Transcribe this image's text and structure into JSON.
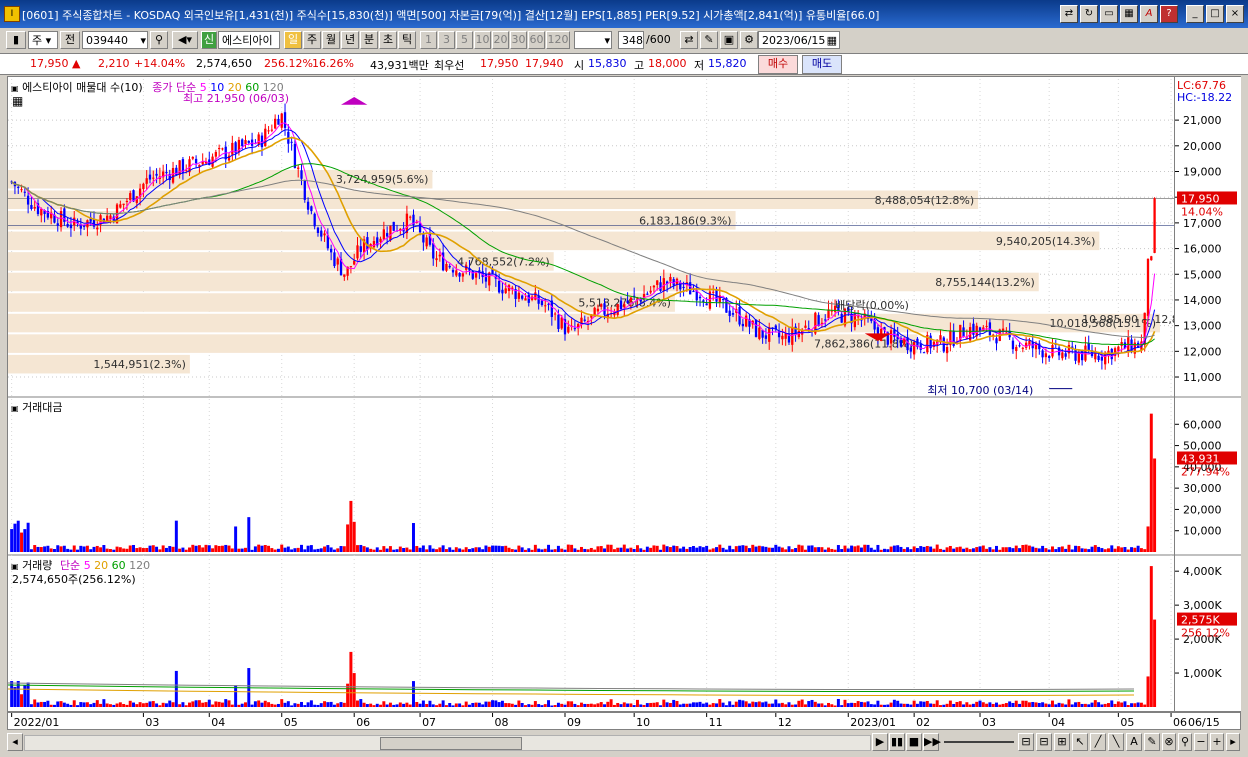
{
  "window": {
    "title": "[0601] 주식종합차트 - KOSDAQ 외국인보유[1,431(천)] 주식수[15,830(천)] 액면[500] 자본금[79(억)] 결산[12월] EPS[1,885] PER[9.52] 시가총액[2,841(억)] 유통비율[66.0]"
  },
  "toolbar": {
    "market": "주",
    "scope": "전",
    "code": "039440",
    "name": "에스티아이",
    "periods": [
      "일",
      "주",
      "월",
      "년",
      "분",
      "초",
      "틱"
    ],
    "active_period": "일",
    "intervals": [
      "1",
      "3",
      "5",
      "10",
      "20",
      "30",
      "60",
      "120"
    ],
    "count": "348",
    "count_total": "/600",
    "date": "2023/06/15"
  },
  "quote": {
    "price": "17,950",
    "arrow": "▲",
    "change": "2,210",
    "change_pct": "+14.04%",
    "volume": "2,574,650",
    "volume_ratio": "256.12%",
    "turnover": "16.26%",
    "amount": "43,931백만",
    "best_label": "최우선",
    "ask": "17,950",
    "bid": "17,940",
    "open_label": "시",
    "open": "15,830",
    "high_label": "고",
    "high": "18,000",
    "low_label": "저",
    "low": "15,820",
    "buy_label": "매수",
    "sell_label": "매도"
  },
  "price_pane": {
    "title": "에스티아이 매물대 수(10)",
    "ma_prefix": "종가 단순",
    "ma_labels": [
      "5",
      "10",
      "20",
      "60",
      "120"
    ],
    "ma_colors": [
      "#ff00ff",
      "#0000ff",
      "#e0a000",
      "#00a000",
      "#808080"
    ],
    "high_note": "최고 21,950 (06/03)",
    "low_note": "최저 10,700 (03/14)",
    "dividend_note": "배당락(0.00%)",
    "range_note": "10,985.00 ~ 12,890.00",
    "lc": "LC:67.76",
    "hc": "HC:-18.22",
    "y_ticks": [
      "21,000",
      "20,000",
      "19,000",
      "18,000",
      "17,000",
      "16,000",
      "15,000",
      "14,000",
      "13,000",
      "12,000",
      "11,000"
    ],
    "current_price_tag": "17,950",
    "current_pct_tag": "14.04%",
    "volume_profile": [
      {
        "label": "1,544,951(2.3%)",
        "price_low": 11100,
        "price_high": 11900,
        "fraction": 0.03
      },
      {
        "label": "7,862,386(11.8%)",
        "price_low": 11900,
        "price_high": 12700,
        "fraction": 0.15
      },
      {
        "label": "10,018,568(15.1%)",
        "price_low": 12700,
        "price_high": 13500,
        "fraction": 0.19
      },
      {
        "label": "5,518,276(8.4%)",
        "price_low": 13500,
        "price_high": 14300,
        "fraction": 0.11
      },
      {
        "label": "8,755,144(13.2%)",
        "price_low": 14300,
        "price_high": 15100,
        "fraction": 0.17
      },
      {
        "label": "4,768,552(7.2%)",
        "price_low": 15100,
        "price_high": 15900,
        "fraction": 0.09
      },
      {
        "label": "9,540,205(14.3%)",
        "price_low": 15900,
        "price_high": 16700,
        "fraction": 0.18
      },
      {
        "label": "6,183,186(9.3%)",
        "price_low": 16700,
        "price_high": 17500,
        "fraction": 0.12
      },
      {
        "label": "8,488,054(12.8%)",
        "price_low": 17500,
        "price_high": 18300,
        "fraction": 0.16
      },
      {
        "label": "3,724,959(5.6%)",
        "price_low": 18300,
        "price_high": 19100,
        "fraction": 0.07
      }
    ]
  },
  "amount_pane": {
    "title": "거래대금",
    "y_ticks": [
      "60,000",
      "50,000",
      "40,000",
      "30,000",
      "20,000",
      "10,000"
    ],
    "tag_value": "43,931",
    "tag_pct": "277.94%"
  },
  "volume_pane": {
    "title": "거래량",
    "ma_prefix": "단순",
    "ma_labels": [
      "5",
      "20",
      "60",
      "120"
    ],
    "note": "2,574,650주(256.12%)",
    "y_ticks": [
      "4,000K",
      "3,000K",
      "2,000K",
      "1,000K"
    ],
    "tag_value": "2,575K",
    "tag_pct": "256.12%"
  },
  "xaxis": {
    "labels": [
      "2022/01",
      "03",
      "04",
      "05",
      "06",
      "07",
      "08",
      "09",
      "10",
      "11",
      "12",
      "2023/01",
      "02",
      "03",
      "04",
      "05",
      "06"
    ],
    "end_label": "06/15"
  },
  "colors": {
    "up": "#ff0000",
    "down": "#0000ff",
    "profile": "#f5e6d3",
    "title_bar": "#0a3a8a"
  }
}
